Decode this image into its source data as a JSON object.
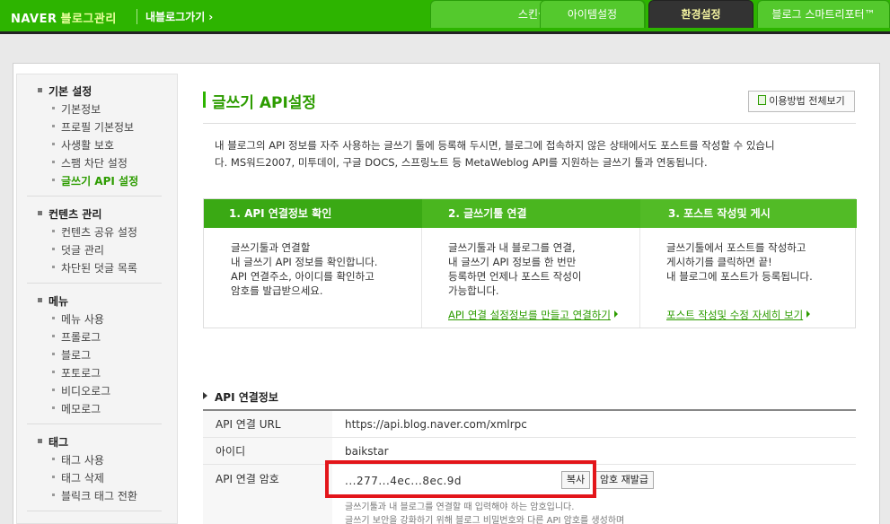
{
  "header": {
    "logo_naver": "NAVER",
    "logo_blog": "블로그관리",
    "go_blog": "내블로그가기",
    "tabs": [
      "스킨설정",
      "아이템설정",
      "환경설정",
      "블로그 스마트리포터™"
    ],
    "active_tab": "환경설정"
  },
  "sidebar": {
    "groups": [
      {
        "label": "기본 설정",
        "items": [
          "기본정보",
          "프로필 기본정보",
          "사생활 보호",
          "스팸 차단 설정",
          "글쓰기 API 설정"
        ]
      },
      {
        "label": "컨텐츠 관리",
        "items": [
          "컨텐츠 공유 설정",
          "덧글 관리",
          "차단된 덧글 목록"
        ]
      },
      {
        "label": "메뉴",
        "items": [
          "메뉴 사용",
          "프롤로그",
          "블로그",
          "포토로그",
          "비디오로그",
          "메모로그"
        ]
      },
      {
        "label": "태그",
        "items": [
          "태그 사용",
          "태그 삭제",
          "블릭크 태그 전환"
        ]
      }
    ],
    "active_item": "글쓰기 API 설정"
  },
  "main": {
    "title": "글쓰기 API설정",
    "guide_button": "이용방법 전체보기",
    "description_line1": "내 블로그의 API 정보를 자주 사용하는 글쓰기 툴에 등록해 두시면, 블로그에 접속하지 않은 상태에서도 포스트를 작성할 수 있습니",
    "description_line2": "다. MS워드2007, 미투데이, 구글 DOCS, 스프링노트 등 MetaWeblog API를 지원하는 글쓰기 툴과 연동됩니다.",
    "steps": [
      {
        "title": "1. API 연결정보 확인",
        "lines": [
          "글쓰기툴과 연결할",
          "내 글쓰기 API 정보를 확인합니다.",
          "API 연결주소, 아이디를 확인하고",
          "암호를 발급받으세요."
        ],
        "link": ""
      },
      {
        "title": "2. 글쓰기툴 연결",
        "lines": [
          "글쓰기툴과 내 블로그를 연결,",
          "내 글쓰기 API 정보를 한 번만",
          "등록하면 언제나 포스트 작성이",
          "가능합니다."
        ],
        "link": "API 연결 설정정보를 만들고 연결하기"
      },
      {
        "title": "3. 포스트 작성및 게시",
        "lines": [
          "글쓰기툴에서 포스트를 작성하고",
          "게시하기를 클릭하면 끝!",
          "내 블로그에 포스트가 등록됩니다."
        ],
        "link": "포스트 작성및 수정 자세히 보기"
      }
    ],
    "api_section_title": "API 연결정보",
    "api_rows": [
      {
        "label": "API 연결 URL",
        "value": "https://api.blog.naver.com/xmlrpc"
      },
      {
        "label": "아이디",
        "value": "baikstar"
      },
      {
        "label": "API 연결 암호",
        "value": "...277...4ec...8ec.9d"
      }
    ],
    "copy_button": "복사",
    "reissue_button": "암호 재발급",
    "note_lines": [
      "글쓰기툴과 내 블로그를 연결할 때 입력해야 하는 암호입니다.",
      "글쓰기 보안을 강화하기 위해 블로그 비밀번호와 다른 API 암호를 생성하며"
    ]
  }
}
